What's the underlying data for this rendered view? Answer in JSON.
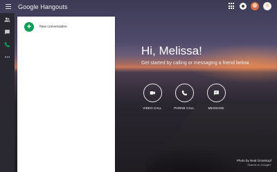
{
  "app": {
    "title_google": "Google",
    "title_product": "Hangouts"
  },
  "topbar": {
    "menu_icon": "hamburger-menu-icon",
    "apps_icon": "apps-grid-icon",
    "status_icon": "status-icon",
    "avatars": [
      "avatar-1",
      "avatar-2"
    ]
  },
  "rail": {
    "items": [
      {
        "icon": "contacts-icon"
      },
      {
        "icon": "chat-icon"
      },
      {
        "icon": "phone-icon"
      },
      {
        "icon": "more-icon"
      }
    ]
  },
  "panel": {
    "new_conversation_label": "New conversation"
  },
  "main": {
    "greeting": "Hi, Melissa!",
    "subtitle": "Get started by calling or messaging a friend below.",
    "actions": [
      {
        "label": "VIDEO CALL",
        "icon": "videocam-icon"
      },
      {
        "label": "PHONE CALL",
        "icon": "phone-icon"
      },
      {
        "label": "MESSAGE",
        "icon": "message-icon"
      }
    ]
  },
  "credit": {
    "photo_by": "Photo by Neal Grosskopf",
    "shared_on": "Shared on Google+"
  },
  "colors": {
    "accent_green": "#0f9d58",
    "rail_bg": "#2a2830",
    "panel_bg": "#ffffff"
  }
}
